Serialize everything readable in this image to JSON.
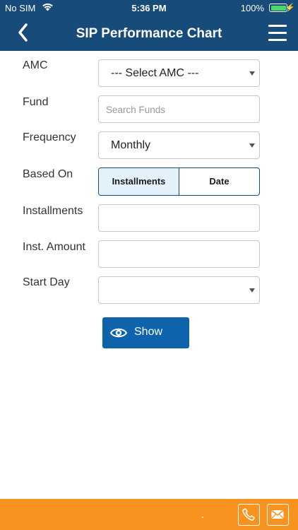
{
  "status_bar": {
    "carrier": "No SIM",
    "time": "5:36 PM",
    "battery": "100%",
    "battery_level": 1.0
  },
  "header": {
    "title": "SIP Performance Chart"
  },
  "form": {
    "amc": {
      "label": "AMC",
      "value": "--- Select AMC ---"
    },
    "fund": {
      "label": "Fund",
      "placeholder": "Search Funds",
      "value": ""
    },
    "frequency": {
      "label": "Frequency",
      "value": "Monthly"
    },
    "based_on": {
      "label": "Based On",
      "options": [
        "Installments",
        "Date"
      ],
      "selected": "Installments"
    },
    "installments": {
      "label": "Installments",
      "value": ""
    },
    "inst_amount": {
      "label": "Inst. Amount",
      "value": ""
    },
    "start_day": {
      "label": "Start Day",
      "value": ""
    },
    "show_button": {
      "label": "Show",
      "icon": "eye-icon"
    }
  },
  "footer": {
    "icons": [
      "phone-icon",
      "mail-icon"
    ]
  },
  "colors": {
    "header_bg": "#164b7a",
    "button_bg": "#0f63ac",
    "footer_bg": "#f7931e",
    "segment_active_bg": "#e3f1fb"
  }
}
